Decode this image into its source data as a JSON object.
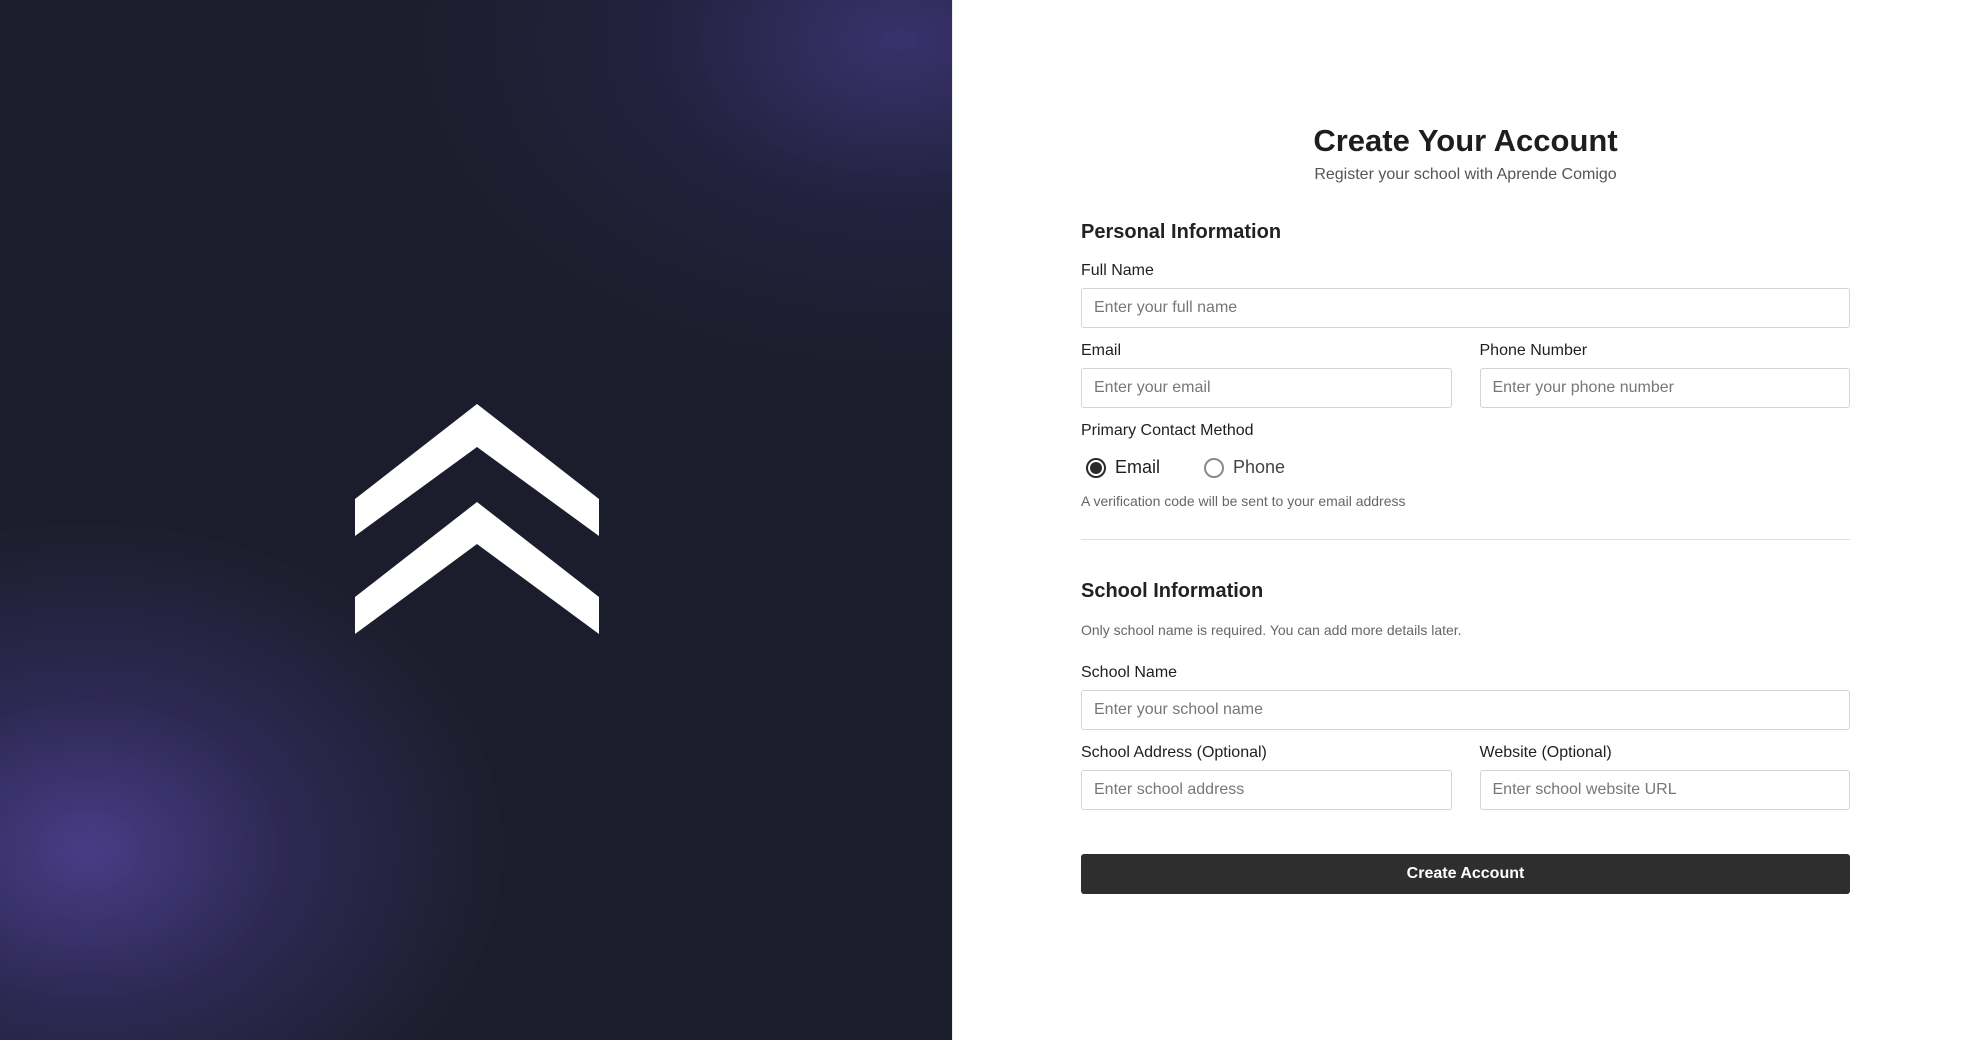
{
  "brand": {
    "logo_icon": "double-chevron-up-icon",
    "colors": {
      "panel_dark": "#1c1d2c",
      "panel_glow": "#504296",
      "button": "#2e2e2e",
      "logo": "#ffffff"
    }
  },
  "header": {
    "title": "Create Your Account",
    "subtitle": "Register your school with Aprende Comigo"
  },
  "personal": {
    "section_title": "Personal Information",
    "full_name": {
      "label": "Full Name",
      "placeholder": "Enter your full name",
      "value": ""
    },
    "email": {
      "label": "Email",
      "placeholder": "Enter your email",
      "value": ""
    },
    "phone": {
      "label": "Phone Number",
      "placeholder": "Enter your phone number",
      "value": ""
    },
    "contact_method": {
      "label": "Primary Contact Method",
      "options": [
        {
          "label": "Email",
          "selected": true
        },
        {
          "label": "Phone",
          "selected": false
        }
      ],
      "hint": "A verification code will be sent to your email address"
    }
  },
  "school": {
    "section_title": "School Information",
    "note": "Only school name is required. You can add more details later.",
    "name": {
      "label": "School Name",
      "placeholder": "Enter your school name",
      "value": ""
    },
    "address": {
      "label": "School Address (Optional)",
      "placeholder": "Enter school address",
      "value": ""
    },
    "website": {
      "label": "Website (Optional)",
      "placeholder": "Enter school website URL",
      "value": ""
    }
  },
  "submit_label": "Create Account"
}
